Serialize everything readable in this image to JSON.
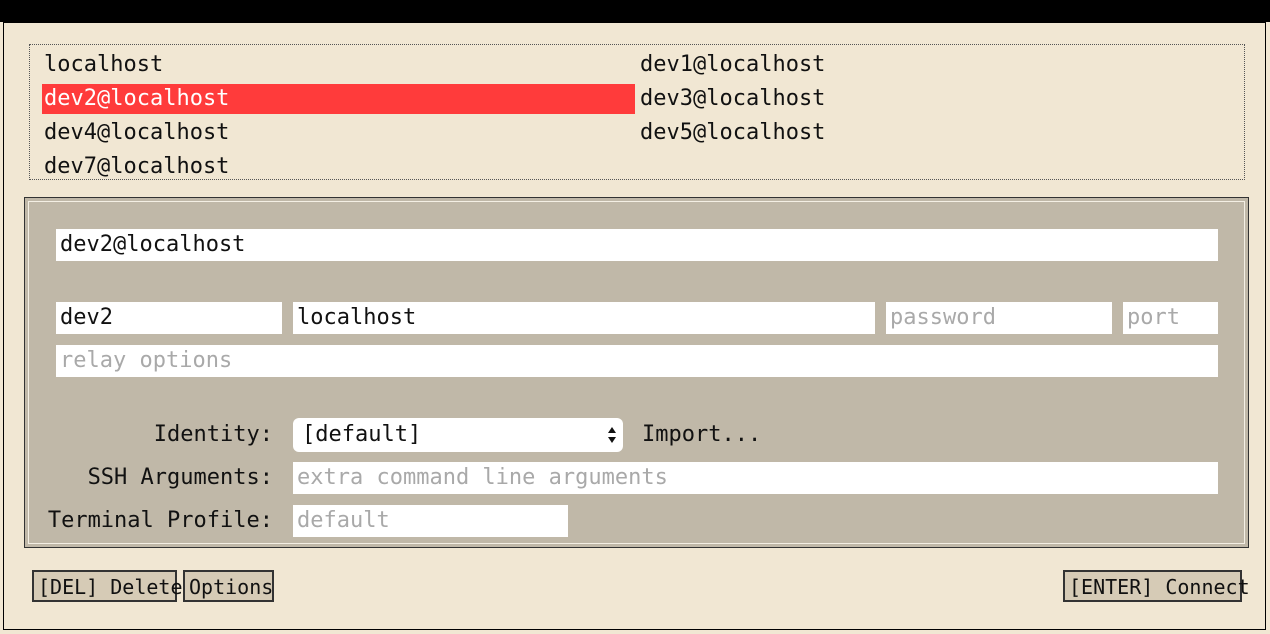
{
  "hosts": [
    {
      "label": "localhost"
    },
    {
      "label": "dev1@localhost"
    },
    {
      "label": "dev2@localhost"
    },
    {
      "label": "dev3@localhost"
    },
    {
      "label": "dev4@localhost"
    },
    {
      "label": "dev5@localhost"
    },
    {
      "label": "dev7@localhost"
    }
  ],
  "selected_host": "dev2@localhost",
  "form": {
    "connection": {
      "value": "dev2@localhost"
    },
    "user": {
      "value": "dev2"
    },
    "host": {
      "value": "localhost"
    },
    "password": {
      "placeholder": "password"
    },
    "port": {
      "placeholder": "port"
    },
    "relay": {
      "placeholder": "relay options"
    },
    "identity": {
      "label": "Identity:",
      "selected": "[default]",
      "import_label": "Import..."
    },
    "ssh_arguments": {
      "label": "SSH Arguments:",
      "placeholder": "extra command line arguments"
    },
    "terminal_profile": {
      "label": "Terminal Profile:",
      "placeholder": "default"
    }
  },
  "buttons": {
    "delete": "[DEL] Delete",
    "options": "Options",
    "connect": "[ENTER] Connect"
  },
  "colors": {
    "background": "#f1e7d3",
    "panel": "#c0b8a8",
    "selection": "#ff3b3b"
  }
}
